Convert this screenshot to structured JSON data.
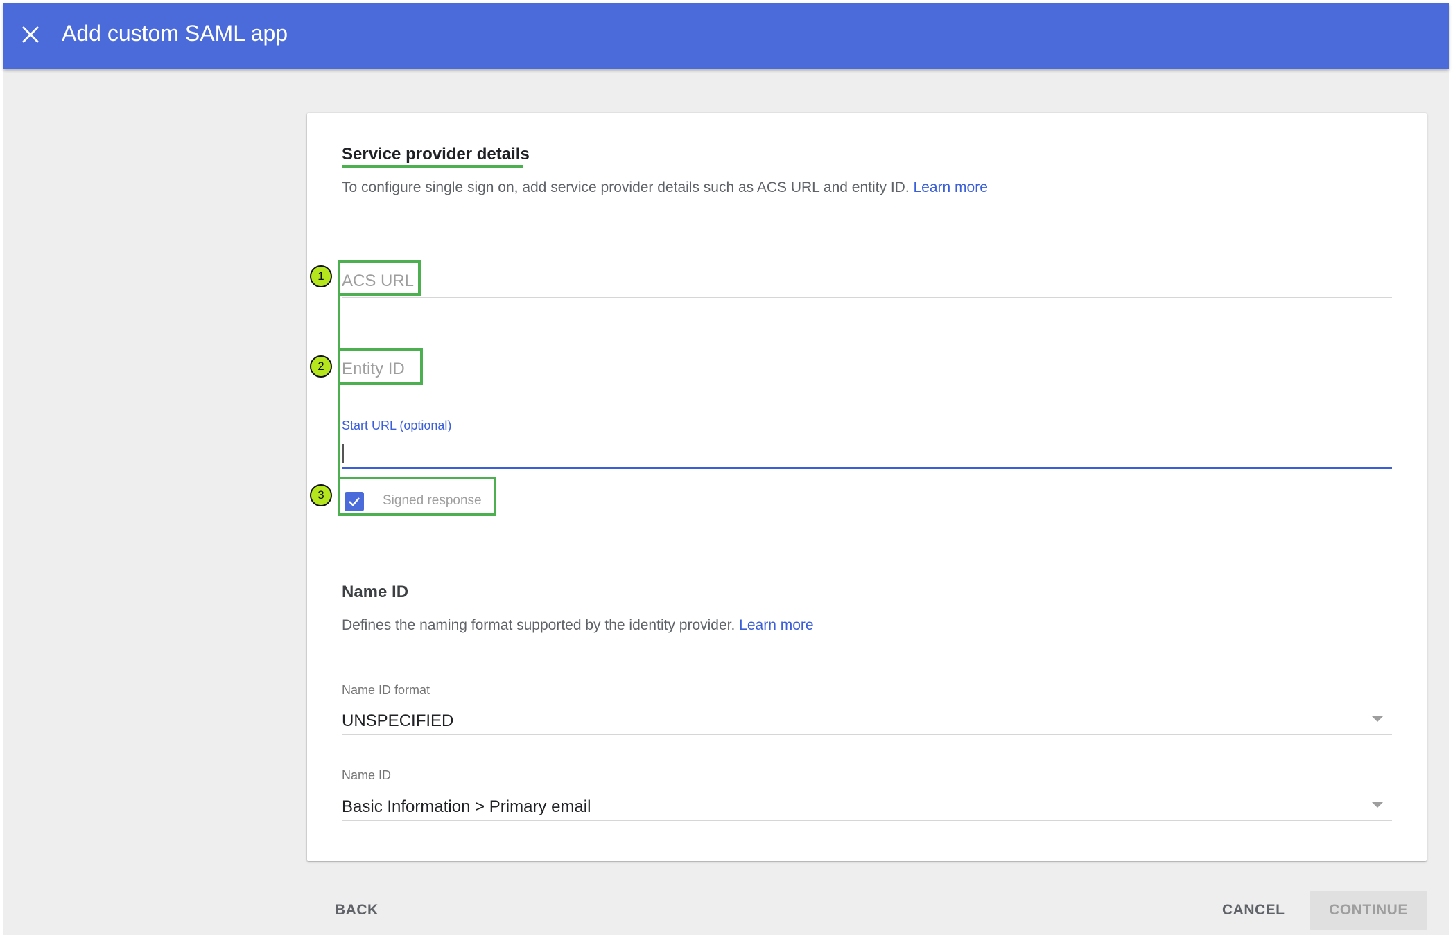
{
  "header": {
    "close_icon": "close-icon",
    "title": "Add custom SAML app"
  },
  "service_provider": {
    "title": "Service provider details",
    "description": "To configure single sign on, add service provider details such as ACS URL and entity ID.",
    "learn_more": "Learn more",
    "acs_url_placeholder": "ACS URL",
    "entity_id_placeholder": "Entity ID",
    "start_url_label": "Start URL (optional)",
    "start_url_value": "",
    "signed_response_label": "Signed response",
    "signed_response_checked": true
  },
  "name_id_section": {
    "title": "Name ID",
    "description": "Defines the naming format supported by the identity provider.",
    "learn_more": "Learn more",
    "format_label": "Name ID format",
    "format_value": "UNSPECIFIED",
    "name_id_label": "Name ID",
    "name_id_value": "Basic Information > Primary email"
  },
  "annotations": [
    "1",
    "2",
    "3"
  ],
  "footer": {
    "back": "BACK",
    "cancel": "CANCEL",
    "continue": "CONTINUE"
  },
  "colors": {
    "header_bg": "#4a6bd9",
    "accent": "#3b5fd9",
    "annotation_green": "#4caf50",
    "annotation_badge": "#b5e61d",
    "page_bg": "#eeeeee"
  }
}
